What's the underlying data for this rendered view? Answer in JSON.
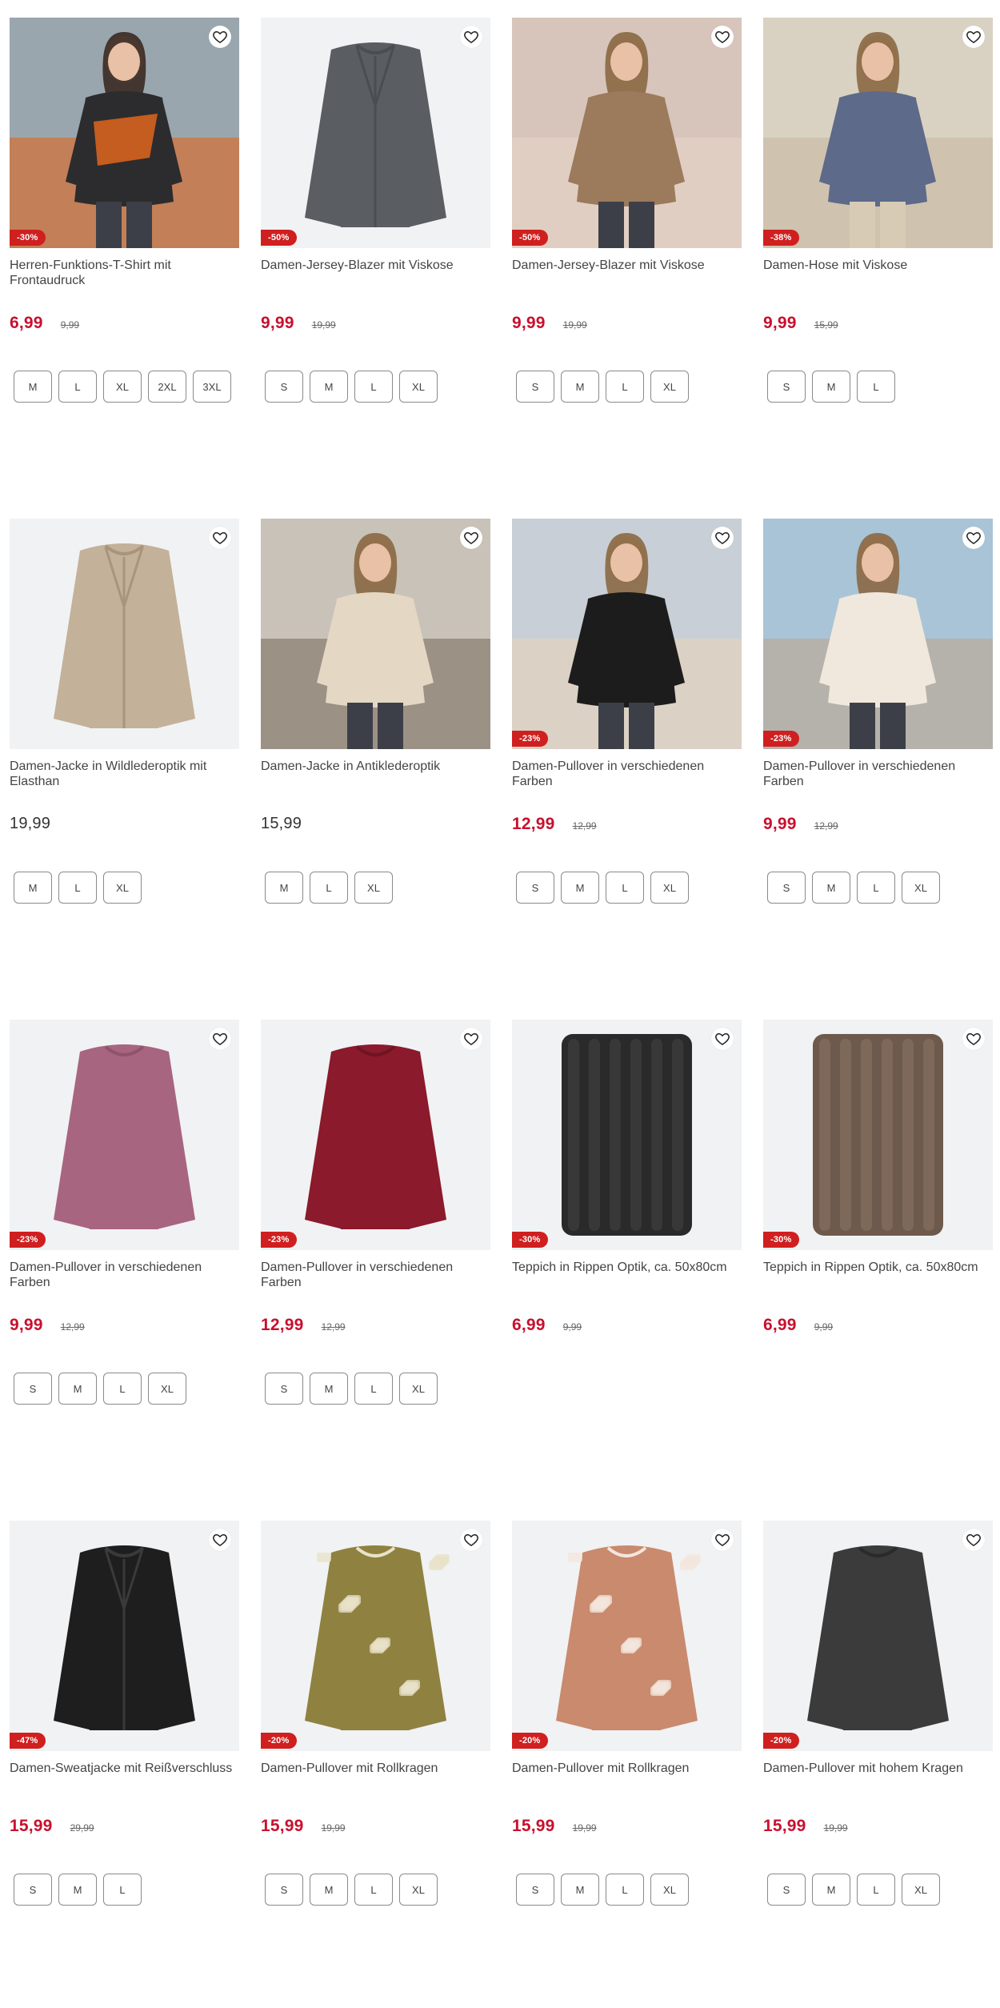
{
  "products": [
    {
      "title": "Herren-Funktions-T-Shirt mit Frontaudruck",
      "badge": "-30%",
      "price": "6,99",
      "old_price": "9,99",
      "sizes": [
        "M",
        "L",
        "XL",
        "2XL",
        "3XL"
      ],
      "image": "man-tshirt-power",
      "bg": "#9aa6ae",
      "fg": "#2c2c2e",
      "accent": "#e0651d"
    },
    {
      "title": "Damen-Jersey-Blazer mit Viskose",
      "badge": "-50%",
      "price": "9,99",
      "old_price": "19,99",
      "sizes": [
        "S",
        "M",
        "L",
        "XL"
      ],
      "image": "grey-blazer",
      "bg": "#f1f2f3",
      "fg": "#5a5e63",
      "accent": "#4a4e53"
    },
    {
      "title": "Damen-Jersey-Blazer mit Viskose",
      "badge": "-50%",
      "price": "9,99",
      "old_price": "19,99",
      "sizes": [
        "S",
        "M",
        "L",
        "XL"
      ],
      "image": "woman-brown-blazer",
      "bg": "#d7c5bb",
      "fg": "#9c7a5c",
      "accent": "#e7d4c6"
    },
    {
      "title": "Damen-Hose mit Viskose",
      "badge": "-38%",
      "price": "9,99",
      "old_price": "15,99",
      "sizes": [
        "S",
        "M",
        "L"
      ],
      "image": "woman-patterned-pants",
      "bg": "#d9d2c2",
      "fg": "#5d6a89",
      "accent": "#c8b7a2"
    },
    {
      "title": "Damen-Jacke in Wildlederoptik mit Elasthan",
      "badge": "",
      "price": "19,99",
      "old_price": "",
      "sizes": [
        "M",
        "L",
        "XL"
      ],
      "image": "suede-jacket",
      "bg": "#f1f2f3",
      "fg": "#c3b19a",
      "accent": "#a8957c"
    },
    {
      "title": "Damen-Jacke in Antiklederoptik",
      "badge": "",
      "price": "15,99",
      "old_price": "",
      "sizes": [
        "M",
        "L",
        "XL"
      ],
      "image": "woman-beige-jacket",
      "bg": "#c9c2b8",
      "fg": "#e4d8c4",
      "accent": "#7d6f63"
    },
    {
      "title": "Damen-Pullover in verschiedenen Farben",
      "badge": "-23%",
      "price": "12,99",
      "old_price": "12,99",
      "sizes": [
        "S",
        "M",
        "L",
        "XL"
      ],
      "image": "woman-black-pullover",
      "bg": "#c9cfd6",
      "fg": "#1c1c1c",
      "accent": "#e8d2b8"
    },
    {
      "title": "Damen-Pullover in verschiedenen Farben",
      "badge": "-23%",
      "price": "9,99",
      "old_price": "12,99",
      "sizes": [
        "S",
        "M",
        "L",
        "XL"
      ],
      "image": "woman-cream-pullover",
      "bg": "#a9c4d6",
      "fg": "#f0e8dc",
      "accent": "#bca78e"
    },
    {
      "title": "Damen-Pullover in verschiedenen Farben",
      "badge": "-23%",
      "price": "9,99",
      "old_price": "12,99",
      "sizes": [
        "S",
        "M",
        "L",
        "XL"
      ],
      "image": "mauve-pullover",
      "bg": "#f1f2f3",
      "fg": "#a7657f",
      "accent": "#8f536b"
    },
    {
      "title": "Damen-Pullover in verschiedenen Farben",
      "badge": "-23%",
      "price": "12,99",
      "old_price": "12,99",
      "sizes": [
        "S",
        "M",
        "L",
        "XL"
      ],
      "image": "burgundy-pullover",
      "bg": "#f1f2f3",
      "fg": "#8a1a2c",
      "accent": "#6e1422"
    },
    {
      "title": "Teppich in Rippen Optik, ca. 50x80cm",
      "badge": "-30%",
      "price": "6,99",
      "old_price": "9,99",
      "sizes": [],
      "image": "black-rug",
      "bg": "#f1f2f3",
      "fg": "#2a2a2a",
      "accent": "#444444"
    },
    {
      "title": "Teppich in Rippen Optik, ca. 50x80cm",
      "badge": "-30%",
      "price": "6,99",
      "old_price": "9,99",
      "sizes": [],
      "image": "brown-rug",
      "bg": "#f1f2f3",
      "fg": "#6e5a4c",
      "accent": "#8a7564"
    },
    {
      "title": "Damen-Sweatjacke mit Reißverschluss",
      "badge": "-47%",
      "price": "15,99",
      "old_price": "29,99",
      "sizes": [
        "S",
        "M",
        "L"
      ],
      "image": "black-sweatjacket",
      "bg": "#f1f2f3",
      "fg": "#1e1e1e",
      "accent": "#3a3a3a"
    },
    {
      "title": "Damen-Pullover mit Rollkragen",
      "badge": "-20%",
      "price": "15,99",
      "old_price": "19,99",
      "sizes": [
        "S",
        "M",
        "L",
        "XL"
      ],
      "image": "olive-pattern-pullover",
      "bg": "#f1f2f3",
      "fg": "#8f8140",
      "accent": "#e8e2c8"
    },
    {
      "title": "Damen-Pullover mit Rollkragen",
      "badge": "-20%",
      "price": "15,99",
      "old_price": "19,99",
      "sizes": [
        "S",
        "M",
        "L",
        "XL"
      ],
      "image": "rust-pattern-pullover",
      "bg": "#f1f2f3",
      "fg": "#c98a6e",
      "accent": "#f3e6dc"
    },
    {
      "title": "Damen-Pullover mit hohem Kragen",
      "badge": "-20%",
      "price": "15,99",
      "old_price": "19,99",
      "sizes": [
        "S",
        "M",
        "L",
        "XL"
      ],
      "image": "charcoal-pullover",
      "bg": "#f1f2f3",
      "fg": "#3b3b3b",
      "accent": "#2a2a2a"
    }
  ],
  "icons": {
    "favorite": "heart-outline-icon"
  },
  "colors": {
    "sale_red": "#c8102e",
    "badge_red": "#d01f1f"
  }
}
